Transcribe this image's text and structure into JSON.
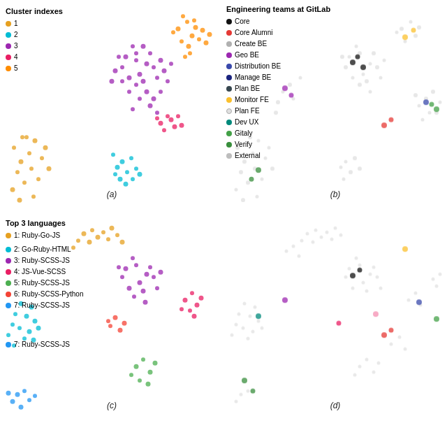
{
  "panels": [
    {
      "id": "a",
      "label": "(a)",
      "legend_title": "Cluster indexes",
      "legend_items": [
        {
          "label": "1",
          "color": "#e6a020"
        },
        {
          "label": "2",
          "color": "#00bcd4"
        },
        {
          "label": "3",
          "color": "#9c27b0"
        },
        {
          "label": "4",
          "color": "#e91e63"
        },
        {
          "label": "5",
          "color": "#ff8c00"
        }
      ]
    },
    {
      "id": "b",
      "label": "(b)",
      "legend_title": "Engineering teams at GitLab",
      "legend_items": [
        {
          "label": "Core",
          "color": "#111111"
        },
        {
          "label": "Core Alumni",
          "color": "#e53935"
        },
        {
          "label": "Create BE",
          "color": "#b0b0b0"
        },
        {
          "label": "Geo BE",
          "color": "#9c27b0"
        },
        {
          "label": "Distribution BE",
          "color": "#3949ab"
        },
        {
          "label": "Manage BE",
          "color": "#1a237e"
        },
        {
          "label": "Plan BE",
          "color": "#37474f"
        },
        {
          "label": "Monitor FE",
          "color": "#fbc02d"
        },
        {
          "label": "Plan FE",
          "color": "#e0e0e0"
        },
        {
          "label": "Dev UX",
          "color": "#00897b"
        },
        {
          "label": "Gitaly",
          "color": "#43a047"
        },
        {
          "label": "Verify",
          "color": "#388e3c"
        },
        {
          "label": "External",
          "color": "#bdbdbd"
        }
      ]
    },
    {
      "id": "c",
      "label": "(c)",
      "legend_title": "Top 3 languages",
      "legend_items": [
        {
          "label": "1: Ruby-Go-JS",
          "color": "#e6a020"
        },
        {
          "label": "2: Go-Ruby-HTML",
          "color": "#00bcd4"
        },
        {
          "label": "3: Ruby-SCSS-JS",
          "color": "#9c27b0"
        },
        {
          "label": "4: JS-Vue-SCSS",
          "color": "#e91e63"
        },
        {
          "label": "5: Ruby-SCSS-JS",
          "color": "#4caf50"
        },
        {
          "label": "6: Ruby-SCSS-Python",
          "color": "#f44336"
        },
        {
          "label": "7: Ruby-SCSS-JS",
          "color": "#2196f3"
        }
      ]
    },
    {
      "id": "d",
      "label": "(d)"
    }
  ]
}
